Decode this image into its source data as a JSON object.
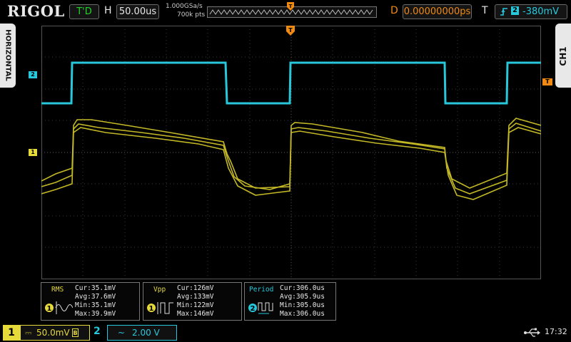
{
  "header": {
    "brand": "RIGOL",
    "run_status": "T'D",
    "horizontal_letter": "H",
    "timebase": "50.00us",
    "sample_rate": "1.000GSa/s",
    "memory_depth": "700k pts",
    "delay_letter": "D",
    "delay_value": "0.00000000ps",
    "trigger_letter": "T",
    "trigger_level": "-380mV",
    "trigger_source": "2",
    "trigger_edge_icon": "rising-edge-icon"
  },
  "side_tabs": {
    "left": "HORIZONTAL",
    "right": "CH1"
  },
  "markers": {
    "ch2": "2",
    "ch1": "1",
    "trigger_level": "T",
    "trigger_position": "T"
  },
  "measurements": [
    {
      "name": "RMS",
      "channel": "1",
      "lines": [
        "Cur:35.1mV",
        "Avg:37.6mV",
        "Min:35.1mV",
        "Max:39.9mV"
      ]
    },
    {
      "name": "Vpp",
      "channel": "1",
      "lines": [
        "Cur:126mV",
        "Avg:133mV",
        "Min:122mV",
        "Max:146mV"
      ]
    },
    {
      "name": "Period",
      "channel": "2",
      "lines": [
        "Cur:306.0us",
        "Avg:305.9us",
        "Min:305.0us",
        "Max:306.0us"
      ]
    }
  ],
  "footer": {
    "ch1_number": "1",
    "ch1_coupling_symbol": "⎓",
    "ch1_scale": "50.0mV",
    "ch1_bw_icon": "bandwidth-limit-icon",
    "ch2_number": "2",
    "ch2_coupling_symbol": "~",
    "ch2_scale": "2.00 V",
    "usb_icon": "usb-icon",
    "time": "17:32"
  },
  "colors": {
    "ch1": "#e6d93a",
    "ch2": "#27c8dc",
    "trigger": "#f08a12",
    "run": "#25d42a"
  }
}
